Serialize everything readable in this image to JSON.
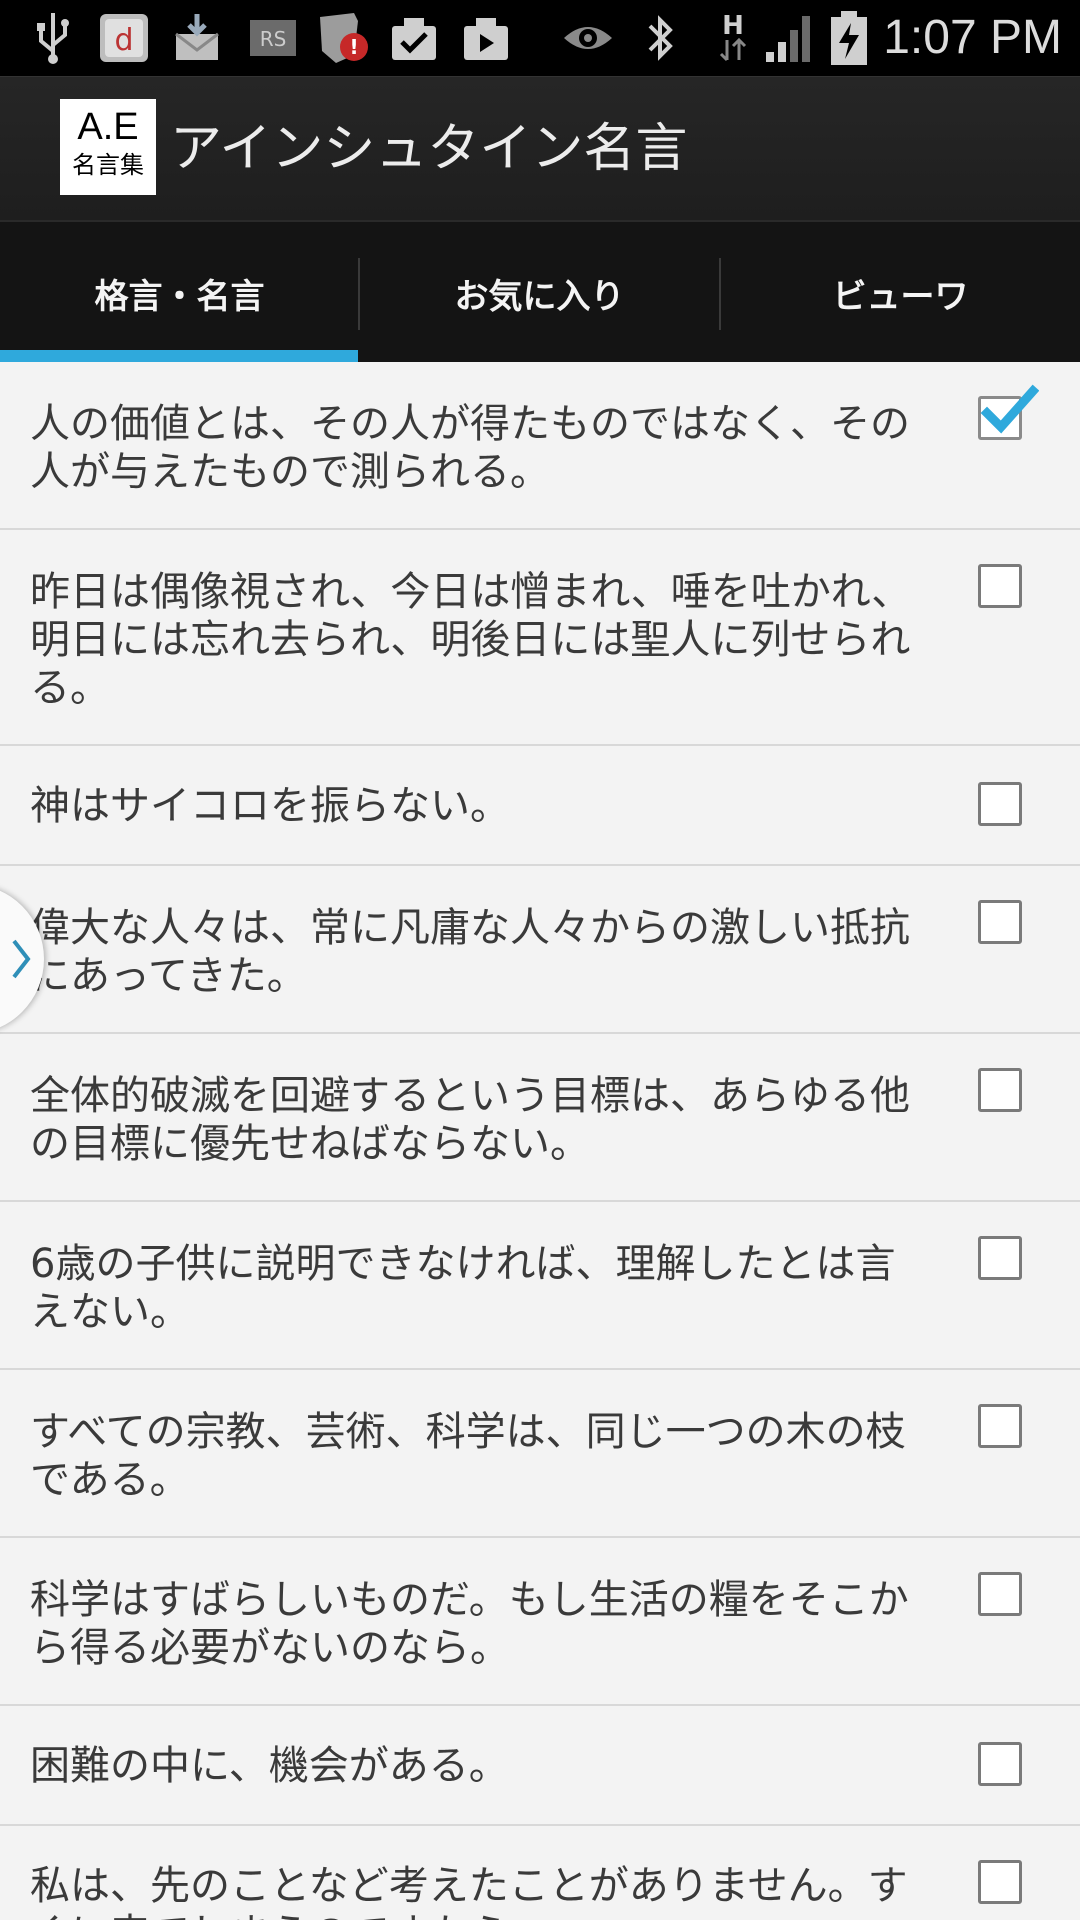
{
  "status_bar": {
    "time": "1:07 PM",
    "icons": [
      "usb-icon",
      "music-app-icon",
      "mail-download-icon",
      "rs-app-icon",
      "shield-alert-icon",
      "clipboard-check-icon",
      "clipboard-play-icon",
      "eye-icon",
      "bluetooth-icon",
      "h-signal-icon",
      "signal-bars-icon",
      "battery-charging-icon"
    ]
  },
  "app": {
    "logo_line1": "A.E",
    "logo_line2": "名言集",
    "title": "アインシュタイン名言"
  },
  "tabs": [
    {
      "label": "格言・名言",
      "active": true
    },
    {
      "label": "お気に入り",
      "active": false
    },
    {
      "label": "ビューワ",
      "active": false
    }
  ],
  "quotes": [
    {
      "text": "人の価値とは、その人が得たものではなく、その人が与えたもので測られる。",
      "checked": true
    },
    {
      "text": "昨日は偶像視され、今日は憎まれ、唾を吐かれ、明日には忘れ去られ、明後日には聖人に列せられる。",
      "checked": false
    },
    {
      "text": "神はサイコロを振らない。",
      "checked": false
    },
    {
      "text": "偉大な人々は、常に凡庸な人々からの激しい抵抗にあってきた。",
      "checked": false
    },
    {
      "text": "全体的破滅を回避するという目標は、あらゆる他の目標に優先せねばならない。",
      "checked": false
    },
    {
      "text": "6歳の子供に説明できなければ、理解したとは言えない。",
      "checked": false
    },
    {
      "text": "すべての宗教、芸術、科学は、同じ一つの木の枝である。",
      "checked": false
    },
    {
      "text": "科学はすばらしいものだ。もし生活の糧をそこから得る必要がないのなら。",
      "checked": false
    },
    {
      "text": "困難の中に、機会がある。",
      "checked": false
    },
    {
      "text": "私は、先のことなど考えたことがありません。すぐに来てしまうのですから。",
      "checked": false
    }
  ],
  "colors": {
    "accent": "#2fa9dc",
    "tab_bg": "#141414",
    "actionbar_bg": "#222222",
    "list_bg": "#f3f3f3"
  }
}
